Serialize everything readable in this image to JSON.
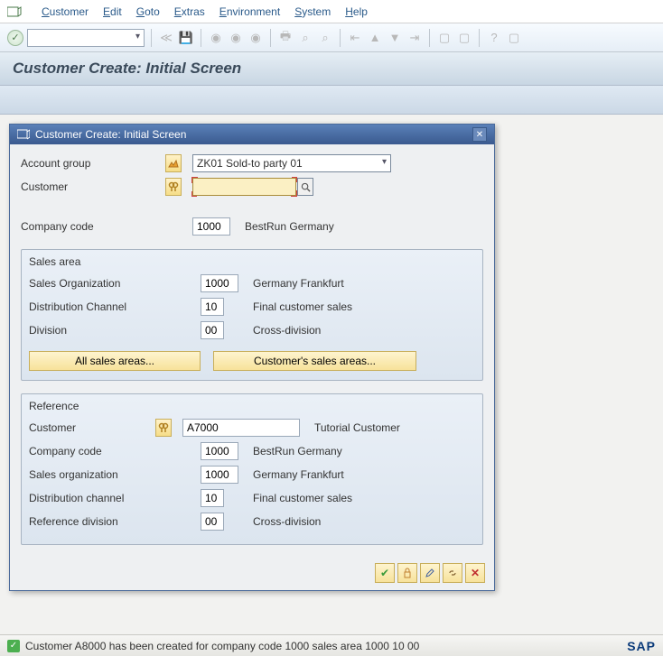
{
  "menu": {
    "items": [
      "Customer",
      "Edit",
      "Goto",
      "Extras",
      "Environment",
      "System",
      "Help"
    ]
  },
  "screen_title": "Customer Create: Initial Screen",
  "modal": {
    "title": "Customer Create: Initial Screen",
    "account_group_label": "Account group",
    "account_group_value": "ZK01 Sold-to party 01",
    "customer_label": "Customer",
    "customer_value": "",
    "company_code_label": "Company code",
    "company_code_value": "1000",
    "company_code_desc": "BestRun Germany",
    "sales_area": {
      "title": "Sales area",
      "sales_org_label": "Sales Organization",
      "sales_org_value": "1000",
      "sales_org_desc": "Germany Frankfurt",
      "dist_channel_label": "Distribution Channel",
      "dist_channel_value": "10",
      "dist_channel_desc": "Final customer sales",
      "division_label": "Division",
      "division_value": "00",
      "division_desc": "Cross-division",
      "all_areas_btn": "All sales areas...",
      "cust_areas_btn": "Customer's sales areas..."
    },
    "reference": {
      "title": "Reference",
      "customer_label": "Customer",
      "customer_value": "A7000",
      "customer_desc": "Tutorial Customer",
      "company_code_label": "Company code",
      "company_code_value": "1000",
      "company_code_desc": "BestRun Germany",
      "sales_org_label": "Sales organization",
      "sales_org_value": "1000",
      "sales_org_desc": "Germany Frankfurt",
      "dist_channel_label": "Distribution channel",
      "dist_channel_value": "10",
      "dist_channel_desc": "Final customer sales",
      "ref_division_label": "Reference division",
      "ref_division_value": "00",
      "ref_division_desc": "Cross-division"
    }
  },
  "status_message": "Customer A8000 has been created for company code 1000 sales area 1000 10 00",
  "logo": "SAP"
}
